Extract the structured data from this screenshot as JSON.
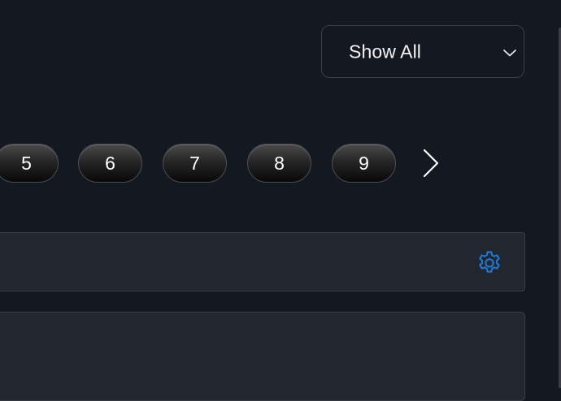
{
  "filter": {
    "selected": "Show All"
  },
  "pagination": {
    "pages": [
      "5",
      "6",
      "7",
      "8",
      "9"
    ],
    "next_icon": "chevron-right-icon"
  },
  "toolbar": {
    "settings_icon": "gear-icon",
    "settings_color": "#1f78d1"
  },
  "colors": {
    "background": "#141820",
    "panel": "#22262e",
    "border": "#3a3f48",
    "accent": "#1f78d1"
  }
}
